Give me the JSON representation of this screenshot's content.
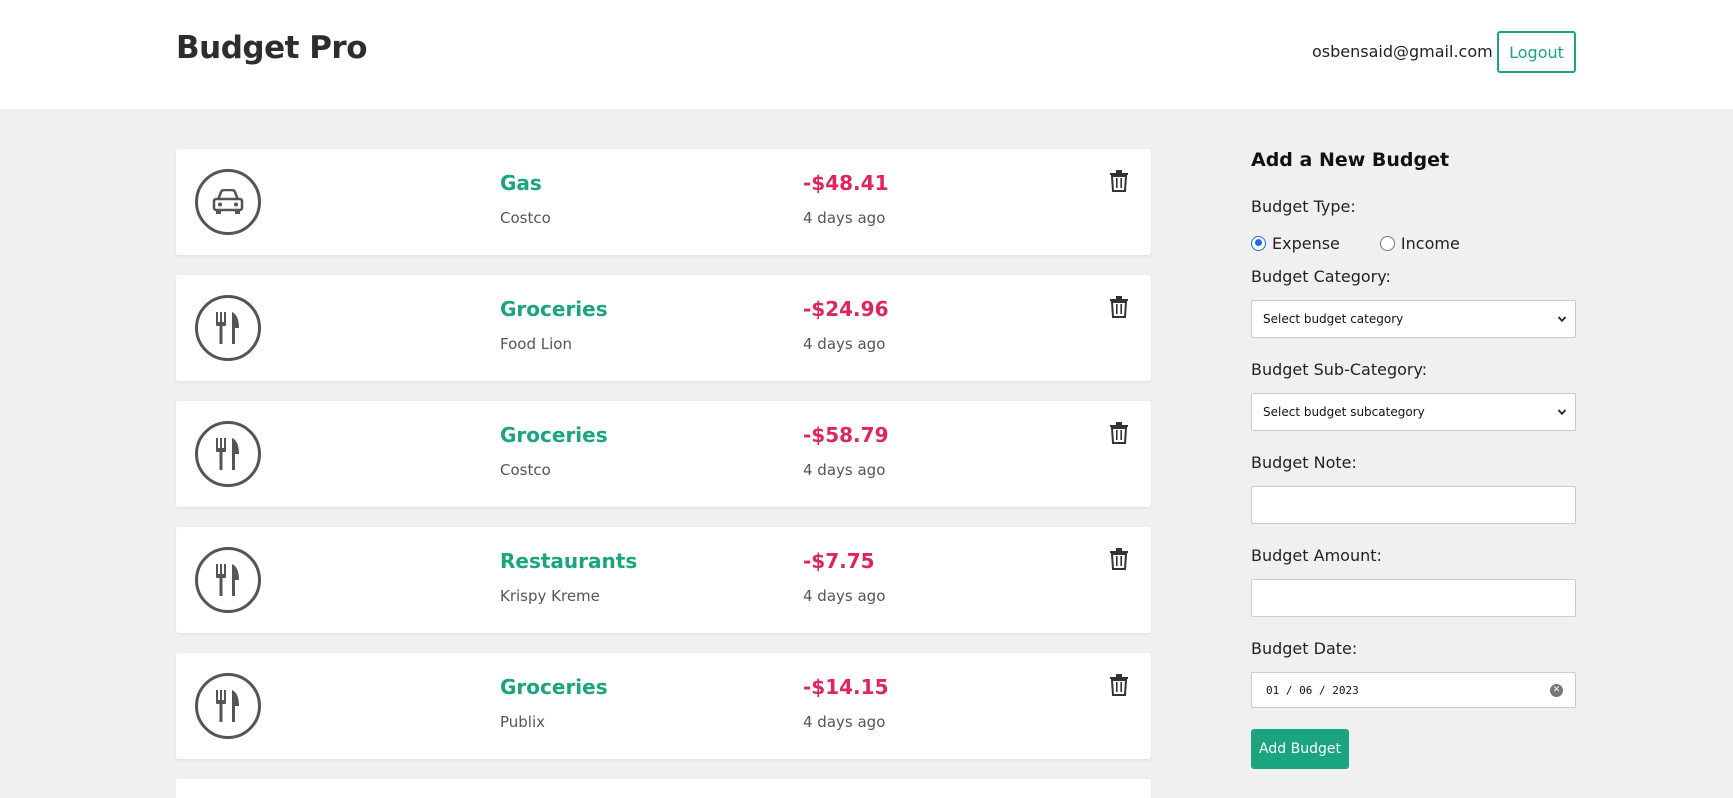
{
  "header": {
    "brand": "Budget Pro",
    "user_email": "osbensaid@gmail.com",
    "logout_label": "Logout"
  },
  "budgets": [
    {
      "category": "Gas",
      "note": "Costco",
      "amount": "-$48.41",
      "date": "4 days ago",
      "icon": "car-icon"
    },
    {
      "category": "Groceries",
      "note": "Food Lion",
      "amount": "-$24.96",
      "date": "4 days ago",
      "icon": "fork-knife-icon"
    },
    {
      "category": "Groceries",
      "note": "Costco",
      "amount": "-$58.79",
      "date": "4 days ago",
      "icon": "fork-knife-icon"
    },
    {
      "category": "Restaurants",
      "note": "Krispy Kreme",
      "amount": "-$7.75",
      "date": "4 days ago",
      "icon": "fork-knife-icon"
    },
    {
      "category": "Groceries",
      "note": "Publix",
      "amount": "-$14.15",
      "date": "4 days ago",
      "icon": "fork-knife-icon"
    }
  ],
  "form": {
    "title": "Add a New Budget",
    "type_label": "Budget Type:",
    "type_options": [
      "Expense",
      "Income"
    ],
    "type_selected": "Expense",
    "category_label": "Budget Category:",
    "category_placeholder": "Select budget category",
    "subcategory_label": "Budget Sub-Category:",
    "subcategory_placeholder": "Select budget subcategory",
    "note_label": "Budget Note:",
    "note_value": "",
    "amount_label": "Budget Amount:",
    "amount_value": "",
    "date_label": "Budget Date:",
    "date_value": "01 / 06 / 2023",
    "submit_label": "Add Budget"
  },
  "colors": {
    "accent": "#1aa57f",
    "expense": "#e0245e",
    "radio_checked": "#1a6fe0",
    "background": "#f0f0f0"
  }
}
